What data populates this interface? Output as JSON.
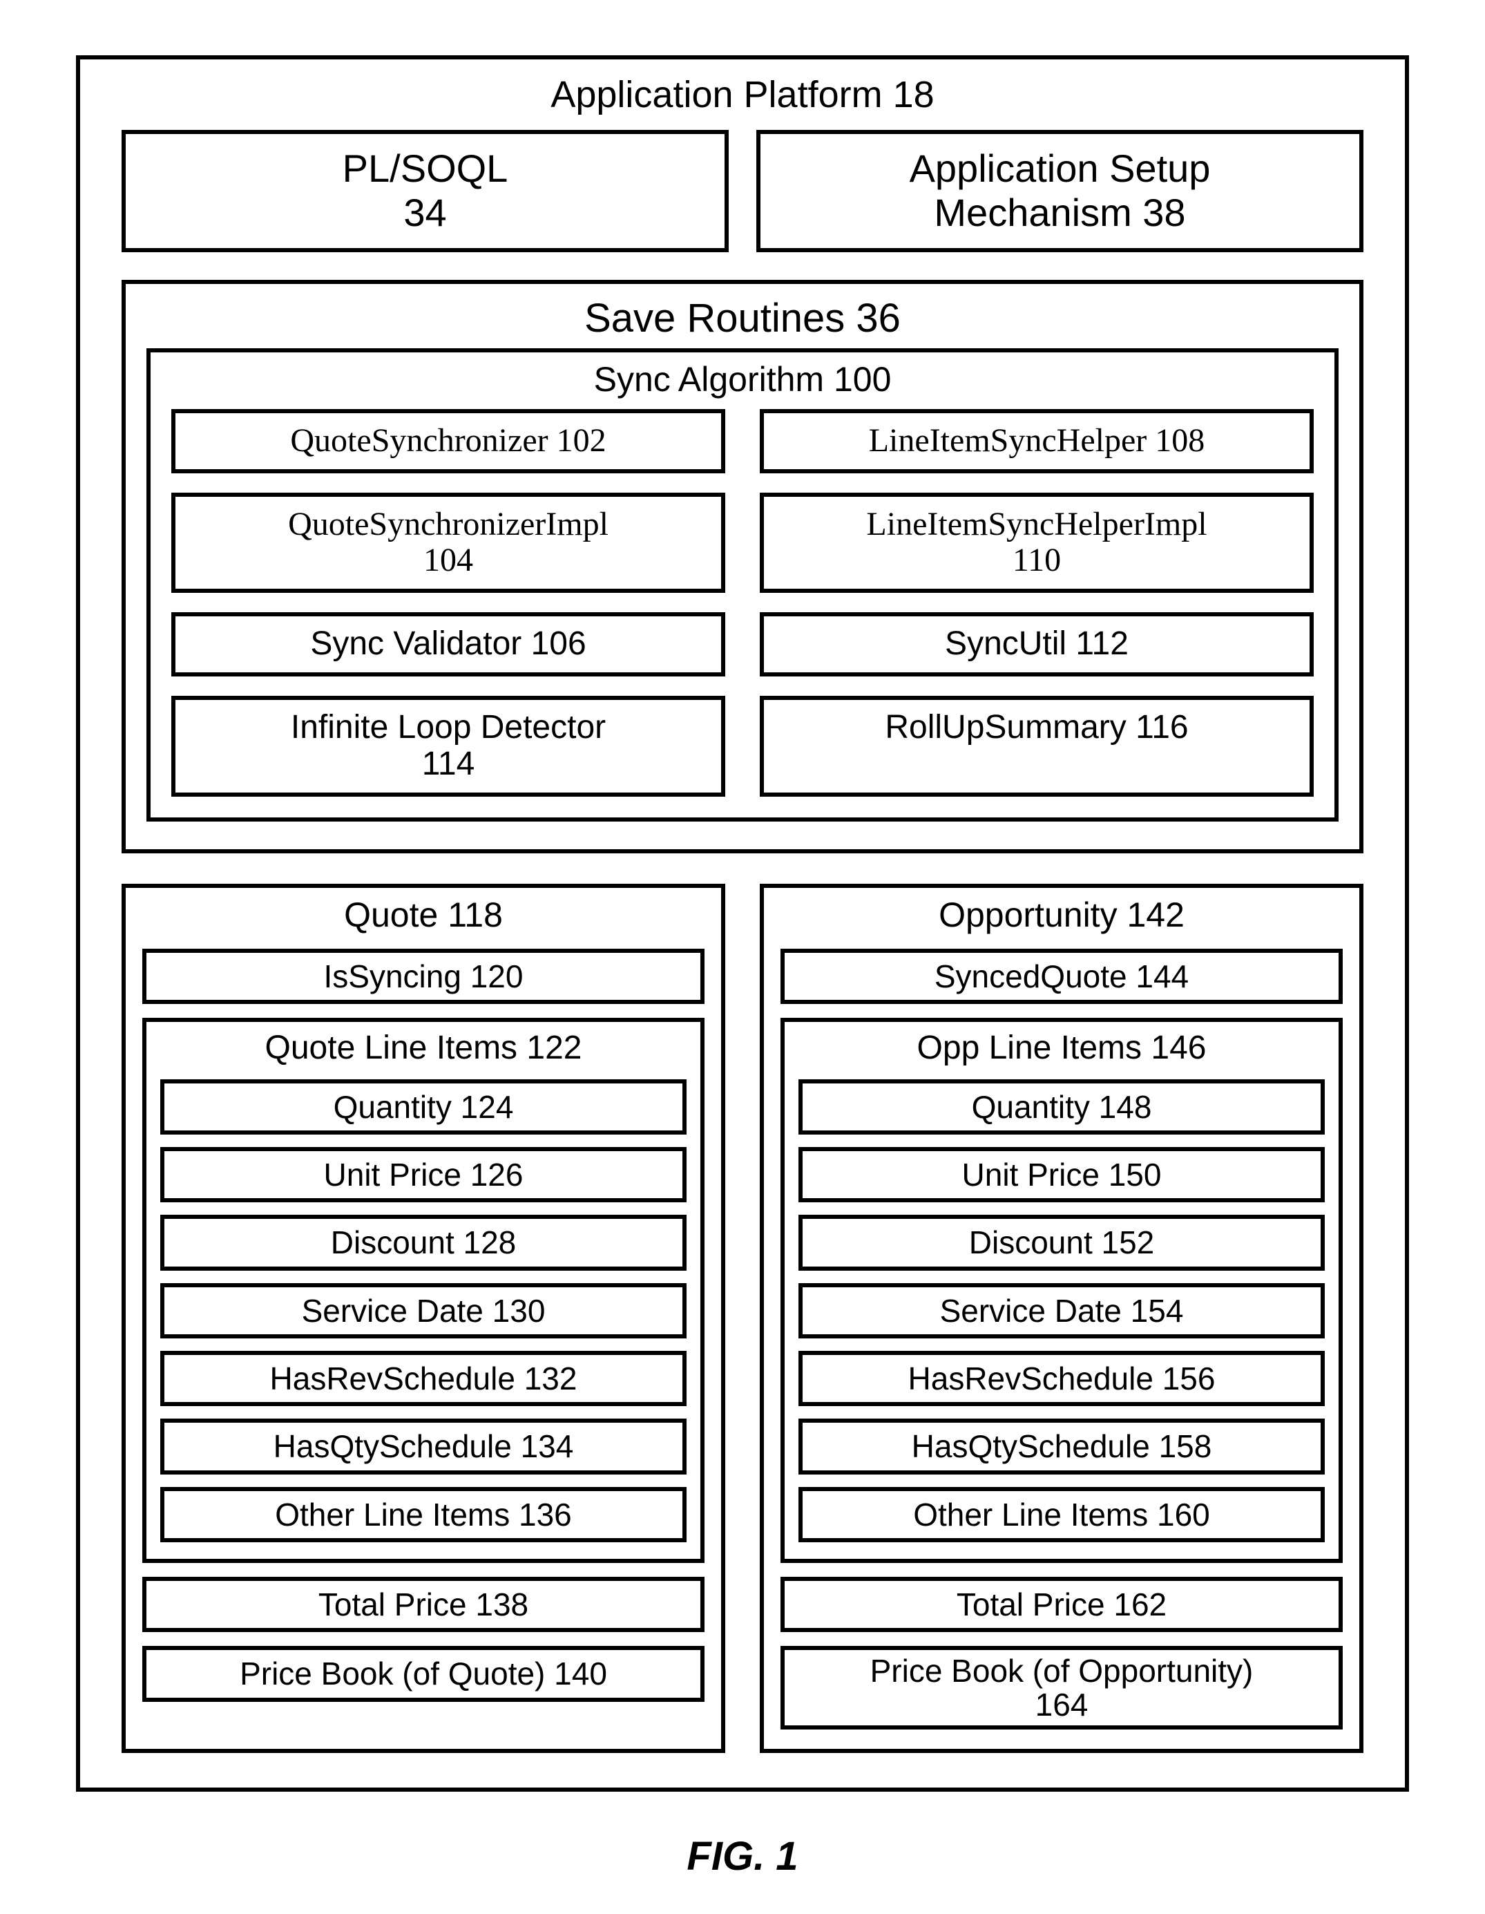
{
  "platform_title": "Application Platform 18",
  "plsoql": "PL/SOQL",
  "plsoql_num": "34",
  "appsetup": "Application Setup",
  "appsetup_line2": "Mechanism 38",
  "save_routines_title": "Save Routines 36",
  "sync_algo_title": "Sync Algorithm 100",
  "sync_boxes": {
    "qs": "QuoteSynchronizer 102",
    "lish": "LineItemSyncHelper 108",
    "qsi": "QuoteSynchronizerImpl",
    "qsi_num": "104",
    "lishi": "LineItemSyncHelperImpl",
    "lishi_num": "110",
    "sv": "Sync Validator 106",
    "su": "SyncUtil 112",
    "ild": "Infinite Loop Detector",
    "ild_num": "114",
    "rus": "RollUpSummary 116"
  },
  "quote": {
    "title": "Quote 118",
    "isSyncing": "IsSyncing 120",
    "lineItemsTitle": "Quote Line Items 122",
    "items": {
      "quantity": "Quantity 124",
      "unitPrice": "Unit Price 126",
      "discount": "Discount 128",
      "serviceDate": "Service Date 130",
      "hasRev": "HasRevSchedule 132",
      "hasQty": "HasQtySchedule 134",
      "other": "Other Line Items 136"
    },
    "total": "Total Price 138",
    "pb": "Price Book (of Quote) 140"
  },
  "opp": {
    "title": "Opportunity 142",
    "synced": "SyncedQuote 144",
    "lineItemsTitle": "Opp Line Items 146",
    "items": {
      "quantity": "Quantity 148",
      "unitPrice": "Unit Price 150",
      "discount": "Discount 152",
      "serviceDate": "Service Date 154",
      "hasRev": "HasRevSchedule 156",
      "hasQty": "HasQtySchedule 158",
      "other": "Other Line Items 160"
    },
    "total": "Total Price 162",
    "pb": "Price Book (of Opportunity)",
    "pb_num": "164"
  },
  "caption": "FIG. 1"
}
